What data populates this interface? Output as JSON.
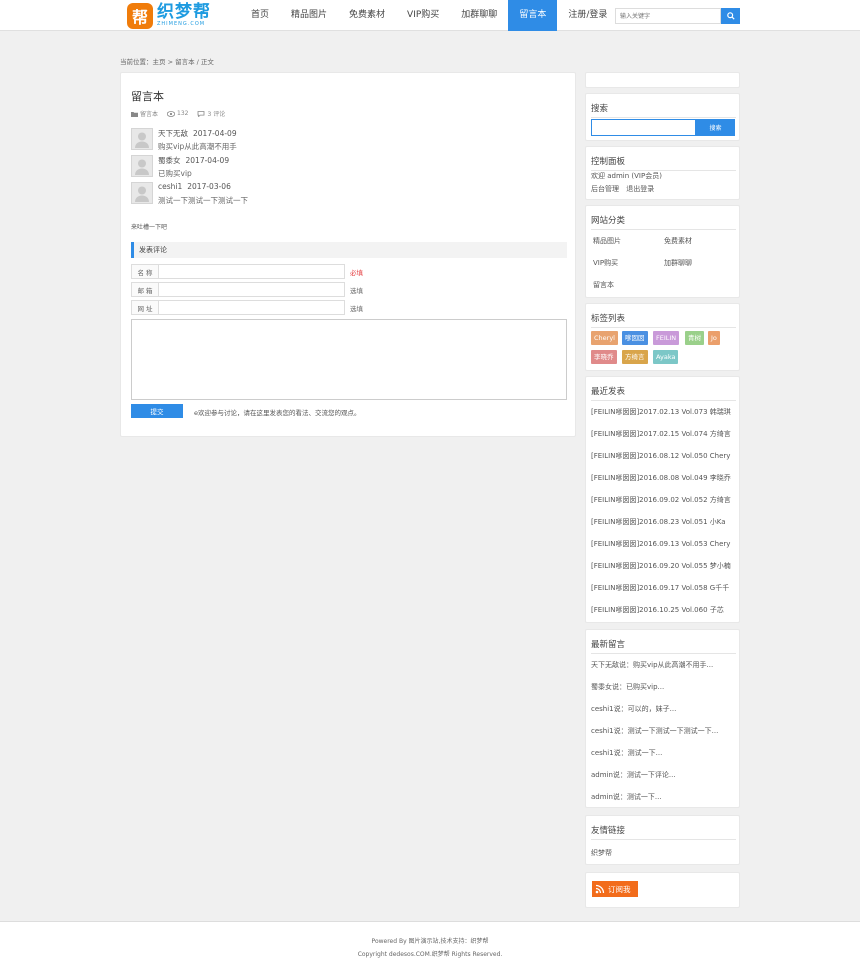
{
  "header": {
    "logo_badge": "帮",
    "logo_text": "织梦帮",
    "logo_sub": "ZHIMENG.COM",
    "nav": [
      {
        "label": "首页"
      },
      {
        "label": "精品图片"
      },
      {
        "label": "免费素材"
      },
      {
        "label": "VIP购买"
      },
      {
        "label": "加群聊聊"
      },
      {
        "label": "留言本",
        "active": true
      },
      {
        "label": "注册/登录"
      }
    ],
    "search_placeholder": "输入关键字",
    "accent": "#2f8ce6"
  },
  "breadcrumb": "当前位置：主页 > 留言本 / 正文",
  "article": {
    "title": "留言本",
    "meta_category": "留言本",
    "meta_views": "132",
    "meta_comments": "3 评论",
    "messages": [
      {
        "author": "天下无敌",
        "date": "2017-04-09",
        "text": "购买vip从此高潮不用手"
      },
      {
        "author": "蜀黍女",
        "date": "2017-04-09",
        "text": "已购买vip"
      },
      {
        "author": "ceshi1",
        "date": "2017-03-06",
        "text": "测试一下测试一下测试一下"
      }
    ],
    "note": "来吐槽一下吧",
    "form": {
      "section_title": "发表评论",
      "name_label": "名 称",
      "name_hint": "必填",
      "email_label": "邮 箱",
      "email_hint": "选填",
      "url_label": "网 址",
      "url_hint": "选填",
      "submit_label": "提交",
      "submit_note": "e欢迎参与讨论，请在这里发表您的看法、交流您的观点。"
    }
  },
  "sidebar": {
    "search": {
      "title": "搜索",
      "button": "搜索"
    },
    "control": {
      "title": "控制面板",
      "welcome": "欢迎 admin (VIP会员)",
      "admin_link": "后台管理",
      "logout_link": "退出登录"
    },
    "categories": {
      "title": "网站分类",
      "items": [
        "精品图片",
        "免费素材",
        "VIP购买",
        "加群聊聊",
        "留言本"
      ]
    },
    "tags": {
      "title": "标签列表",
      "items": [
        {
          "label": "Cheryl",
          "color": "#e8a36f"
        },
        {
          "label": "嗲囡囡",
          "color": "#4a90e2"
        },
        {
          "label": "FEILIN",
          "color": "#c99ad9"
        },
        {
          "label": "青树",
          "color": "#9ad08a"
        },
        {
          "label": "Jo",
          "color": "#eb9f6b"
        },
        {
          "label": "李晓乔",
          "color": "#e08a8a"
        },
        {
          "label": "方绮言",
          "color": "#d9a54b"
        },
        {
          "label": "Ayaka",
          "color": "#7cc7c7"
        }
      ]
    },
    "recent": {
      "title": "最近发表",
      "items": [
        "[FEILIN嗲囡囡]2017.02.13 Vol.073 韩瑞琪",
        "[FEILIN嗲囡囡]2017.02.15 Vol.074 方绮言",
        "[FEILIN嗲囡囡]2016.08.12 Vol.050 Chery",
        "[FEILIN嗲囡囡]2016.08.08 Vol.049 李晓乔",
        "[FEILIN嗲囡囡]2016.09.02 Vol.052 方绮言",
        "[FEILIN嗲囡囡]2016.08.23 Vol.051 小Ka",
        "[FEILIN嗲囡囡]2016.09.13 Vol.053 Chery",
        "[FEILIN嗲囡囡]2016.09.20 Vol.055 梦小楠",
        "[FEILIN嗲囡囡]2016.09.17 Vol.058 G千千",
        "[FEILIN嗲囡囡]2016.10.25 Vol.060 子芯"
      ]
    },
    "comments": {
      "title": "最新留言",
      "items": [
        "天下无敌说：购买vip从此高潮不用手...",
        "蜀黍女说：已购买vip...",
        "ceshi1说：可以的，妹子...",
        "ceshi1说：测试一下测试一下测试一下...",
        "ceshi1说：测试一下...",
        "admin说：测试一下评论...",
        "admin说：测试一下..."
      ]
    },
    "links": {
      "title": "友情链接",
      "items": [
        "织梦帮"
      ]
    },
    "rss": {
      "label": "订阅我"
    }
  },
  "footer": {
    "line1": "Powered By 图片演示站,技术支持：织梦帮",
    "line2": "Copyright dedesos.COM.织梦帮 Rights Reserved."
  }
}
